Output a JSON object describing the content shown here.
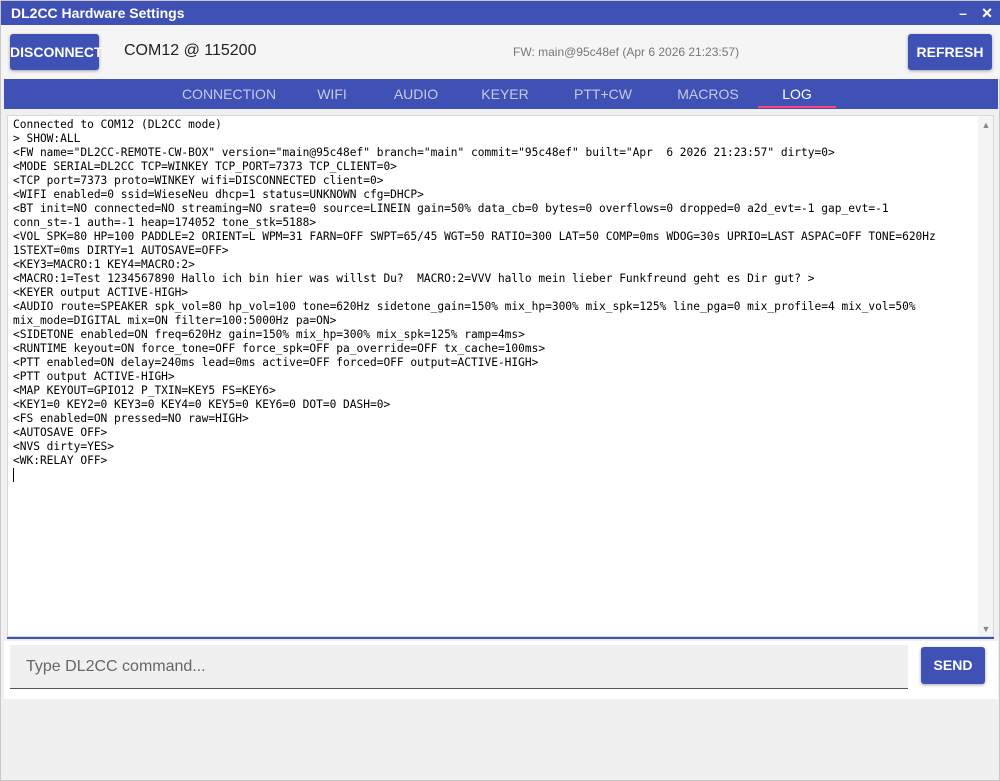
{
  "window": {
    "title": "DL2CC Hardware Settings",
    "minimize_glyph": "–",
    "close_glyph": "×"
  },
  "header": {
    "disconnect_label": "DISCONNECT",
    "port_info": "COM12 @ 115200",
    "fw_info": "FW: main@95c48ef (Apr  6 2026 21:23:57)",
    "refresh_label": "REFRESH"
  },
  "tabs": [
    {
      "label": "CONNECTION"
    },
    {
      "label": "WIFI"
    },
    {
      "label": "AUDIO"
    },
    {
      "label": "KEYER"
    },
    {
      "label": "PTT+CW"
    },
    {
      "label": "MACROS"
    },
    {
      "label": "LOG",
      "active": true
    }
  ],
  "log": {
    "lines": [
      "Connected to COM12 (DL2CC mode)",
      "> SHOW:ALL",
      "<FW name=\"DL2CC-REMOTE-CW-BOX\" version=\"main@95c48ef\" branch=\"main\" commit=\"95c48ef\" built=\"Apr  6 2026 21:23:57\" dirty=0>",
      "<MODE SERIAL=DL2CC TCP=WINKEY TCP_PORT=7373 TCP_CLIENT=0>",
      "<TCP port=7373 proto=WINKEY wifi=DISCONNECTED client=0>",
      "<WIFI enabled=0 ssid=WieseNeu dhcp=1 status=UNKNOWN cfg=DHCP>",
      "<BT init=NO connected=NO streaming=NO srate=0 source=LINEIN gain=50% data_cb=0 bytes=0 overflows=0 dropped=0 a2d_evt=-1 gap_evt=-1",
      "conn_st=-1 auth=-1 heap=174052 tone_stk=5188>",
      "<VOL SPK=80 HP=100 PADDLE=2 ORIENT=L WPM=31 FARN=OFF SWPT=65/45 WGT=50 RATIO=300 LAT=50 COMP=0ms WDOG=30s UPRIO=LAST ASPAC=OFF TONE=620Hz",
      "1STEXT=0ms DIRTY=1 AUTOSAVE=OFF>",
      "<KEY3=MACRO:1 KEY4=MACRO:2>",
      "<MACRO:1=Test 1234567890 Hallo ich bin hier was willst Du?  MACRO:2=VVV hallo mein lieber Funkfreund geht es Dir gut? >",
      "<KEYER output ACTIVE-HIGH>",
      "<AUDIO route=SPEAKER spk_vol=80 hp_vol=100 tone=620Hz sidetone_gain=150% mix_hp=300% mix_spk=125% line_pga=0 mix_profile=4 mix_vol=50%",
      "mix_mode=DIGITAL mix=ON filter=100:5000Hz pa=ON>",
      "<SIDETONE enabled=ON freq=620Hz gain=150% mix_hp=300% mix_spk=125% ramp=4ms>",
      "<RUNTIME keyout=ON force_tone=OFF force_spk=OFF pa_override=OFF tx_cache=100ms>",
      "<PTT enabled=ON delay=240ms lead=0ms active=OFF forced=OFF output=ACTIVE-HIGH>",
      "<PTT output ACTIVE-HIGH>",
      "<MAP KEYOUT=GPIO12 P_TXIN=KEY5 FS=KEY6>",
      "<KEY1=0 KEY2=0 KEY3=0 KEY4=0 KEY5=0 KEY6=0 DOT=0 DASH=0>",
      "<FS enabled=ON pressed=NO raw=HIGH>",
      "<AUTOSAVE OFF>",
      "<NVS dirty=YES>",
      "<WK:RELAY OFF>"
    ]
  },
  "scrollbar": {
    "up_glyph": "▲",
    "down_glyph": "▼"
  },
  "command": {
    "placeholder": "Type DL2CC command...",
    "value": "",
    "send_label": "SEND"
  },
  "colors": {
    "primary": "#3f51b5",
    "tab_indicator": "#ff4081"
  }
}
